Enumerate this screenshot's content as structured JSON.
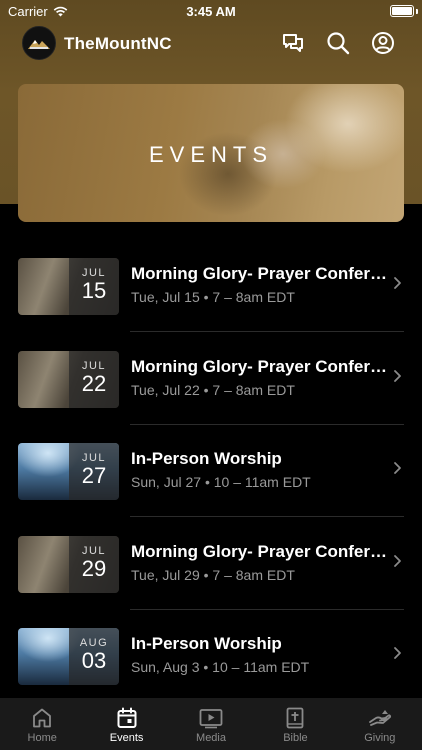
{
  "status_bar": {
    "carrier": "Carrier",
    "time": "3:45 AM"
  },
  "header": {
    "app_name": "TheMountNC",
    "icons": [
      "chat-bubbles-icon",
      "search-icon",
      "account-icon"
    ]
  },
  "banner": {
    "title": "EVENTS"
  },
  "events": [
    {
      "month": "JUL",
      "day": "15",
      "title": "Morning Glory- Prayer Conference Call",
      "subtitle": "Tue, Jul 15 • 7 – 8am EDT",
      "thumbnail": "prayer"
    },
    {
      "month": "JUL",
      "day": "22",
      "title": "Morning Glory- Prayer Conference Call",
      "subtitle": "Tue, Jul 22 • 7 – 8am EDT",
      "thumbnail": "prayer"
    },
    {
      "month": "JUL",
      "day": "27",
      "title": "In-Person Worship",
      "subtitle": "Sun, Jul 27 • 10 – 11am EDT",
      "thumbnail": "worship"
    },
    {
      "month": "JUL",
      "day": "29",
      "title": "Morning Glory- Prayer Conference Call",
      "subtitle": "Tue, Jul 29 • 7 – 8am EDT",
      "thumbnail": "prayer"
    },
    {
      "month": "AUG",
      "day": "03",
      "title": "In-Person Worship",
      "subtitle": "Sun, Aug 3 • 10 – 11am EDT",
      "thumbnail": "worship"
    }
  ],
  "tabs": [
    {
      "label": "Home",
      "icon": "home-icon",
      "active": false
    },
    {
      "label": "Events",
      "icon": "calendar-icon",
      "active": true
    },
    {
      "label": "Media",
      "icon": "play-video-icon",
      "active": false
    },
    {
      "label": "Bible",
      "icon": "bible-icon",
      "active": false
    },
    {
      "label": "Giving",
      "icon": "giving-hand-icon",
      "active": false
    }
  ],
  "colors": {
    "header_gold": "#6e5628",
    "background": "#000000",
    "tab_bar": "#1a1a1a",
    "subtitle_gray": "#9a9a9a"
  }
}
